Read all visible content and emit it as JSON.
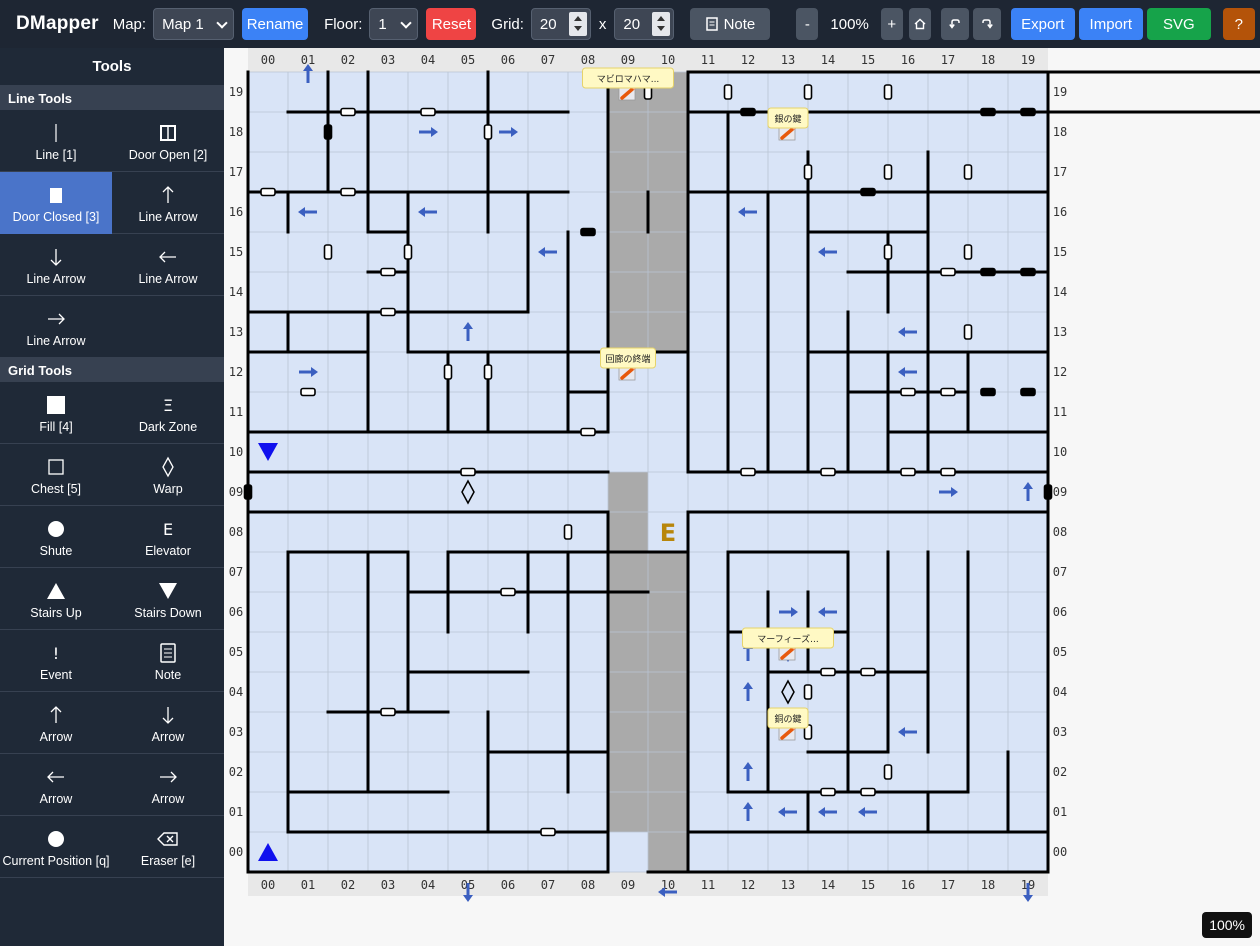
{
  "topbar": {
    "brand": "DMapper",
    "map_label": "Map:",
    "map_value": "Map 1",
    "rename": "Rename",
    "floor_label": "Floor:",
    "floor_value": "1",
    "reset": "Reset",
    "grid_label": "Grid:",
    "grid_w": "20",
    "grid_x": "x",
    "grid_h": "20",
    "note": "Note",
    "zoom_out": "-",
    "zoom": "100%",
    "zoom_in": "+",
    "home_icon": "home-icon",
    "undo_icon": "undo-icon",
    "redo_icon": "redo-icon",
    "export": "Export",
    "import": "Import",
    "svg": "SVG",
    "help": "?"
  },
  "sidebar": {
    "title": "Tools",
    "line_section": "Line Tools",
    "grid_section": "Grid Tools",
    "line_tools": [
      {
        "label": "Line [1]",
        "icon": "line-icon"
      },
      {
        "label": "Door Open [2]",
        "icon": "door-open-icon"
      },
      {
        "label": "Door Closed [3]",
        "icon": "door-closed-icon",
        "active": true
      },
      {
        "label": "Line Arrow",
        "icon": "arrow-up-icon"
      },
      {
        "label": "Line Arrow",
        "icon": "arrow-down-icon"
      },
      {
        "label": "Line Arrow",
        "icon": "arrow-left-icon"
      },
      {
        "label": "Line Arrow",
        "icon": "arrow-right-icon"
      }
    ],
    "grid_tools": [
      {
        "label": "Fill [4]",
        "icon": "fill-icon"
      },
      {
        "label": "Dark Zone",
        "icon": "dark-zone-icon"
      },
      {
        "label": "Chest [5]",
        "icon": "chest-icon"
      },
      {
        "label": "Warp",
        "icon": "warp-icon"
      },
      {
        "label": "Shute",
        "icon": "shute-icon"
      },
      {
        "label": "Elevator",
        "icon": "elevator-icon"
      },
      {
        "label": "Stairs Up",
        "icon": "stairs-up-icon"
      },
      {
        "label": "Stairs Down",
        "icon": "stairs-down-icon"
      },
      {
        "label": "Event",
        "icon": "event-icon"
      },
      {
        "label": "Note",
        "icon": "note-icon"
      },
      {
        "label": "Arrow",
        "icon": "arrow-up-icon"
      },
      {
        "label": "Arrow",
        "icon": "arrow-down-icon"
      },
      {
        "label": "Arrow",
        "icon": "arrow-left-icon"
      },
      {
        "label": "Arrow",
        "icon": "arrow-right-icon"
      },
      {
        "label": "Current Position [q]",
        "icon": "current-position-icon"
      },
      {
        "label": "Eraser [e]",
        "icon": "eraser-icon"
      }
    ]
  },
  "map": {
    "zoom_badge": "100%",
    "col_labels": [
      "00",
      "01",
      "02",
      "03",
      "04",
      "05",
      "06",
      "07",
      "08",
      "09",
      "10",
      "11",
      "12",
      "13",
      "14",
      "15",
      "16",
      "17",
      "18",
      "19"
    ],
    "row_labels": [
      "19",
      "18",
      "17",
      "16",
      "15",
      "14",
      "13",
      "12",
      "11",
      "10",
      "09",
      "08",
      "07",
      "06",
      "05",
      "04",
      "03",
      "02",
      "01",
      "00"
    ],
    "colors": {
      "fill": "#d9e4f7",
      "dark": "#aaaaaa",
      "wall": "#000000",
      "arrow": "#3b5fc0",
      "grid": "#b9c3d3",
      "stairs": "#1010ee",
      "elevator": "#b8860b",
      "note_bg": "#fff9c4"
    },
    "dark_cells": [
      [
        9,
        1
      ],
      [
        9,
        2
      ],
      [
        9,
        3
      ],
      [
        9,
        4
      ],
      [
        9,
        5
      ],
      [
        9,
        6
      ],
      [
        9,
        7
      ],
      [
        9,
        8
      ],
      [
        9,
        9
      ],
      [
        10,
        0
      ],
      [
        10,
        1
      ],
      [
        10,
        2
      ],
      [
        10,
        3
      ],
      [
        10,
        4
      ],
      [
        10,
        5
      ],
      [
        10,
        6
      ],
      [
        10,
        7
      ],
      [
        9,
        12
      ],
      [
        9,
        13
      ],
      [
        9,
        14
      ],
      [
        9,
        15
      ],
      [
        9,
        16
      ],
      [
        9,
        17
      ],
      [
        9,
        18
      ],
      [
        9,
        19
      ],
      [
        10,
        12
      ],
      [
        10,
        13
      ],
      [
        10,
        14
      ],
      [
        10,
        15
      ],
      [
        10,
        16
      ],
      [
        10,
        17
      ],
      [
        10,
        18
      ],
      [
        10,
        19
      ]
    ],
    "clear_cells": [
      [
        9,
        10
      ],
      [
        9,
        11
      ],
      [
        10,
        10
      ],
      [
        10,
        11
      ],
      [
        10,
        12
      ],
      [
        9,
        12
      ]
    ],
    "notes": [
      {
        "x": 9,
        "y": 19,
        "text": "マビロマハマ..."
      },
      {
        "x": 13,
        "y": 18,
        "text": "銀の鍵"
      },
      {
        "x": 9,
        "y": 12,
        "text": "回廊の終端"
      },
      {
        "x": 13,
        "y": 5,
        "text": "マーフィーズ..."
      },
      {
        "x": 13,
        "y": 3,
        "text": "銅の鍵"
      }
    ],
    "elevator": {
      "x": 10,
      "y": 8,
      "glyph": "E"
    },
    "warps": [
      {
        "x": 5,
        "y": 9
      },
      {
        "x": 13,
        "y": 4
      }
    ],
    "stairs_down": [
      {
        "x": 0,
        "y": 10
      }
    ],
    "stairs_up": [
      {
        "x": 0,
        "y": 0
      }
    ],
    "h_walls": [
      [
        0,
        20,
        0,
        9
      ],
      [
        11,
        20,
        20,
        9
      ],
      [
        0,
        19,
        0,
        1
      ],
      [
        1,
        19,
        2,
        1
      ],
      [
        2,
        19,
        6,
        1
      ],
      [
        11,
        19,
        20,
        1
      ],
      [
        0,
        17,
        4,
        1
      ],
      [
        4,
        17,
        2,
        1
      ],
      [
        6,
        17,
        2,
        1
      ],
      [
        11,
        17,
        9,
        1
      ],
      [
        3,
        16,
        1,
        1
      ],
      [
        3,
        15,
        1,
        1
      ],
      [
        14,
        16,
        3,
        1
      ],
      [
        0,
        14,
        7,
        1
      ],
      [
        15,
        15,
        5,
        1
      ],
      [
        0,
        13,
        3,
        1
      ],
      [
        4,
        13,
        7,
        1
      ],
      [
        14,
        13,
        6,
        1
      ],
      [
        8,
        12,
        1,
        1
      ],
      [
        15,
        12,
        3,
        1
      ],
      [
        0,
        11,
        9,
        1
      ],
      [
        11,
        10,
        9,
        1
      ],
      [
        16,
        11,
        1,
        1
      ],
      [
        17,
        11,
        3,
        1
      ],
      [
        0,
        10,
        9,
        1
      ],
      [
        11,
        10,
        9,
        1
      ],
      [
        0,
        9,
        9,
        1
      ],
      [
        9,
        8,
        2,
        1
      ],
      [
        11,
        9,
        9,
        1
      ],
      [
        1,
        8,
        3,
        1
      ],
      [
        5,
        8,
        4,
        1
      ],
      [
        13,
        8,
        2,
        1
      ],
      [
        12,
        8,
        1,
        1
      ],
      [
        4,
        7,
        6,
        1
      ],
      [
        12,
        6,
        3,
        1
      ],
      [
        13,
        5,
        4,
        1
      ],
      [
        4,
        5,
        3,
        1
      ],
      [
        2,
        4,
        3,
        1
      ],
      [
        14,
        3,
        2,
        1
      ],
      [
        13,
        2,
        3,
        1
      ],
      [
        6,
        3,
        3,
        1
      ],
      [
        1,
        2,
        4,
        1
      ],
      [
        12,
        2,
        6,
        1
      ],
      [
        1,
        1,
        8,
        1
      ],
      [
        11,
        1,
        9,
        1
      ],
      [
        0,
        0,
        9,
        1
      ],
      [
        10,
        0,
        10,
        1
      ]
    ],
    "v_walls": [
      [
        0,
        0,
        20
      ],
      [
        20,
        0,
        20
      ],
      [
        9,
        11,
        9
      ],
      [
        11,
        10,
        10
      ],
      [
        9,
        0,
        9
      ],
      [
        11,
        0,
        9
      ],
      [
        2,
        17,
        3
      ],
      [
        1,
        16,
        1
      ],
      [
        3,
        16,
        4
      ],
      [
        4,
        14,
        3
      ],
      [
        6,
        16,
        4
      ],
      [
        8,
        11,
        5
      ],
      [
        3,
        11,
        3
      ],
      [
        5,
        11,
        2
      ],
      [
        6,
        11,
        2
      ],
      [
        4,
        13,
        2
      ],
      [
        7,
        14,
        3
      ],
      [
        1,
        13,
        1
      ],
      [
        12,
        10,
        9
      ],
      [
        13,
        10,
        7
      ],
      [
        14,
        10,
        8
      ],
      [
        15,
        10,
        4
      ],
      [
        16,
        10,
        3
      ],
      [
        17,
        10,
        8
      ],
      [
        18,
        11,
        2
      ],
      [
        16,
        14,
        2
      ],
      [
        17,
        13,
        1
      ],
      [
        10,
        16,
        1
      ],
      [
        1,
        1,
        7
      ],
      [
        3,
        2,
        6
      ],
      [
        4,
        4,
        4
      ],
      [
        5,
        6,
        2
      ],
      [
        7,
        6,
        2
      ],
      [
        6,
        1,
        3
      ],
      [
        8,
        2,
        6
      ],
      [
        12,
        2,
        6
      ],
      [
        13,
        2,
        5
      ],
      [
        14,
        1,
        1
      ],
      [
        15,
        2,
        6
      ],
      [
        16,
        3,
        5
      ],
      [
        17,
        3,
        5
      ],
      [
        18,
        2,
        6
      ],
      [
        17,
        1,
        1
      ],
      [
        19,
        1,
        2
      ],
      [
        14,
        5,
        2
      ]
    ],
    "doors_open": [
      [
        2,
        19,
        "h"
      ],
      [
        4,
        19,
        "h"
      ],
      [
        0,
        17,
        "h"
      ],
      [
        2,
        17,
        "h"
      ],
      [
        6,
        18,
        "v"
      ],
      [
        3,
        15,
        "h"
      ],
      [
        3,
        14,
        "h"
      ],
      [
        2,
        15,
        "v"
      ],
      [
        4,
        15,
        "v"
      ],
      [
        1,
        12,
        "h"
      ],
      [
        5,
        12,
        "v"
      ],
      [
        6,
        12,
        "v"
      ],
      [
        5,
        10,
        "h"
      ],
      [
        8,
        11,
        "h"
      ],
      [
        8,
        8,
        "v"
      ],
      [
        12,
        19,
        "v"
      ],
      [
        14,
        19,
        "v"
      ],
      [
        16,
        19,
        "v"
      ],
      [
        14,
        17,
        "v"
      ],
      [
        16,
        17,
        "v"
      ],
      [
        18,
        17,
        "v"
      ],
      [
        16,
        15,
        "v"
      ],
      [
        18,
        15,
        "v"
      ],
      [
        17,
        15,
        "h"
      ],
      [
        18,
        13,
        "v"
      ],
      [
        16,
        12,
        "h"
      ],
      [
        17,
        12,
        "h"
      ],
      [
        12,
        10,
        "h"
      ],
      [
        14,
        10,
        "h"
      ],
      [
        16,
        10,
        "h"
      ],
      [
        17,
        10,
        "h"
      ],
      [
        6,
        7,
        "h"
      ],
      [
        3,
        4,
        "h"
      ],
      [
        7,
        1,
        "h"
      ],
      [
        14,
        5,
        "h"
      ],
      [
        15,
        5,
        "h"
      ],
      [
        14,
        4,
        "v"
      ],
      [
        14,
        3,
        "v"
      ],
      [
        14,
        2,
        "h"
      ],
      [
        15,
        2,
        "h"
      ],
      [
        16,
        2,
        "v"
      ],
      [
        10,
        19,
        "v"
      ]
    ],
    "doors_closed": [
      [
        2,
        18,
        "v"
      ],
      [
        8,
        16,
        "h"
      ],
      [
        0,
        9,
        "v"
      ],
      [
        20,
        9,
        "v"
      ],
      [
        12,
        19,
        "h"
      ],
      [
        15,
        17,
        "h"
      ],
      [
        18,
        19,
        "h"
      ],
      [
        19,
        19,
        "h"
      ],
      [
        18,
        15,
        "h"
      ],
      [
        19,
        15,
        "h"
      ],
      [
        18,
        12,
        "h"
      ],
      [
        19,
        12,
        "h"
      ]
    ],
    "arrows": [
      [
        1,
        20,
        "u"
      ],
      [
        4,
        19,
        "r"
      ],
      [
        6,
        19,
        "r"
      ],
      [
        1,
        17,
        "l"
      ],
      [
        4,
        17,
        "l"
      ],
      [
        7,
        16,
        "l"
      ],
      [
        5,
        14,
        "u"
      ],
      [
        1,
        13,
        "r"
      ],
      [
        12,
        17,
        "l"
      ],
      [
        14,
        16,
        "l"
      ],
      [
        16,
        14,
        "l"
      ],
      [
        16,
        13,
        "l"
      ],
      [
        17,
        10,
        "r"
      ],
      [
        19,
        10,
        "u"
      ],
      [
        13,
        7,
        "r"
      ],
      [
        14,
        7,
        "l"
      ],
      [
        12,
        6,
        "u"
      ],
      [
        13,
        6,
        "d"
      ],
      [
        12,
        5,
        "u"
      ],
      [
        16,
        4,
        "l"
      ],
      [
        12,
        3,
        "u"
      ],
      [
        12,
        2,
        "u"
      ],
      [
        13,
        2,
        "l"
      ],
      [
        14,
        2,
        "l"
      ],
      [
        15,
        2,
        "l"
      ],
      [
        5,
        0,
        "d"
      ],
      [
        10,
        0,
        "l"
      ],
      [
        19,
        0,
        "d"
      ]
    ]
  }
}
